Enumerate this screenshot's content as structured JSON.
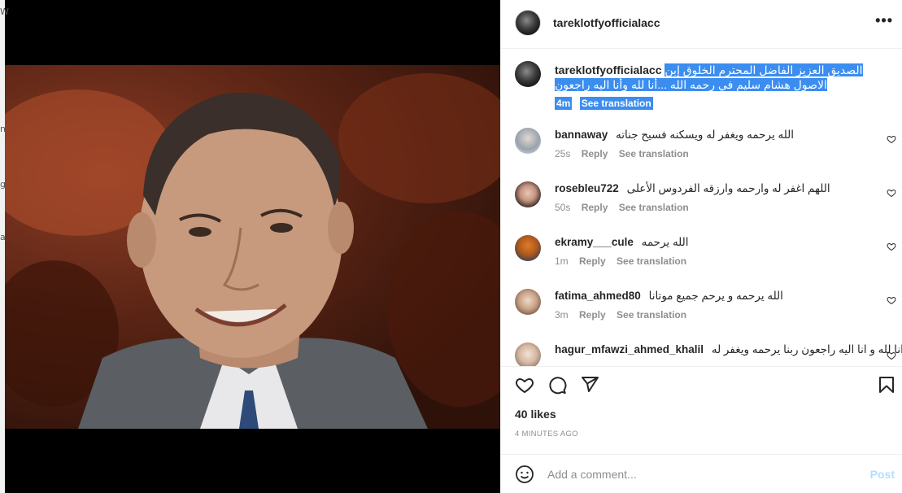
{
  "left_edge_chars": [
    "W",
    "n",
    "g",
    "a"
  ],
  "post": {
    "username": "tareklotfyofficialacc",
    "more_label": "•••",
    "caption": {
      "username": "tareklotfyofficialacc",
      "text": "الصديق العزيز الفاضل المحترم الخلوق إبن الاصول هشام سليم في رحمه الله ...أنا لله وأنا اليه راجعون",
      "time": "4m",
      "translation": "See translation"
    },
    "comments": [
      {
        "user": "bannaway",
        "text": "الله يرحمه ويغفر له ويسكنه فسيح جناته",
        "time": "25s",
        "reply": "Reply",
        "translation": "See translation"
      },
      {
        "user": "rosebleu722",
        "text": "اللهم اغفر له وارحمه وارزقه الفردوس الأعلى",
        "time": "50s",
        "reply": "Reply",
        "translation": "See translation"
      },
      {
        "user": "ekramy___cule",
        "text": "الله يرحمه",
        "time": "1m",
        "reply": "Reply",
        "translation": "See translation"
      },
      {
        "user": "fatima_ahmed80",
        "text": "الله يرحمه و يرحم جميع موتانا",
        "time": "3m",
        "reply": "Reply",
        "translation": "See translation"
      },
      {
        "user": "hagur_mfawzi_ahmed_khalil",
        "text": "انا لله و انا اليه راجعون ربنا يرحمه ويغفر له",
        "time": "",
        "reply": "",
        "translation": ""
      }
    ],
    "likes": "40 likes",
    "posted_ago": "4 MINUTES AGO",
    "add_comment_placeholder": "Add a comment...",
    "post_button": "Post"
  },
  "colors": {
    "highlight": "#3b8df0",
    "muted": "#8e8e8e",
    "post_disabled": "#b2dffc"
  },
  "icons": [
    "more-icon",
    "heart-icon",
    "comment-icon",
    "share-icon",
    "bookmark-icon",
    "emoji-icon"
  ]
}
